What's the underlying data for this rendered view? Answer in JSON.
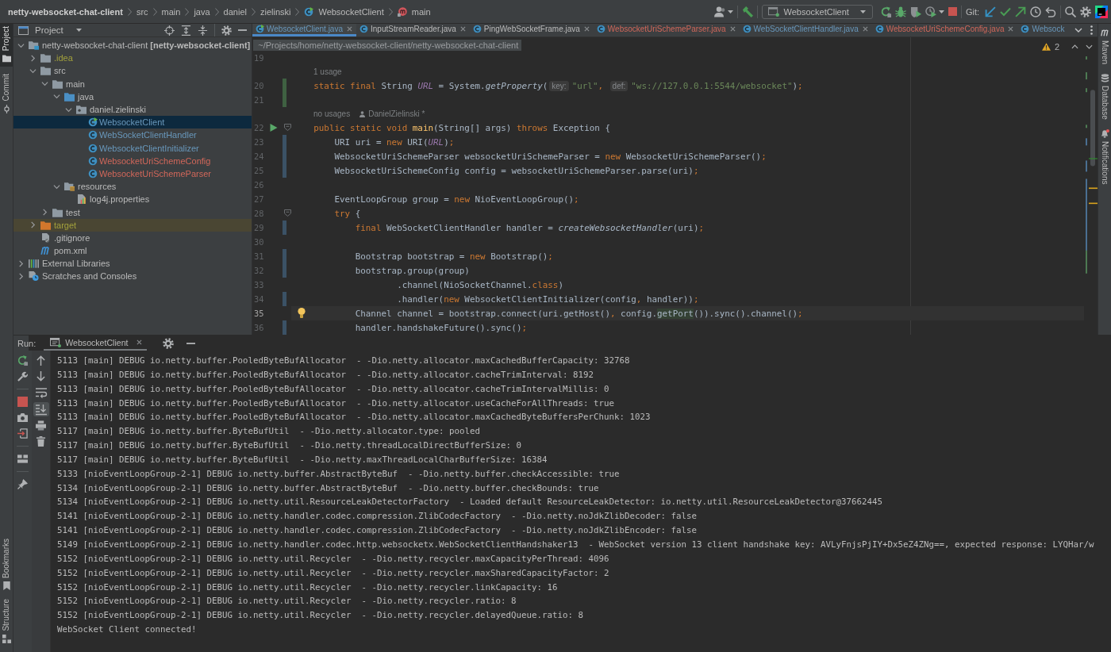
{
  "breadcrumbs": [
    {
      "label": "netty-websocket-chat-client",
      "kind": "project"
    },
    {
      "label": "src",
      "kind": "folder"
    },
    {
      "label": "main",
      "kind": "folder"
    },
    {
      "label": "java",
      "kind": "folder"
    },
    {
      "label": "daniel",
      "kind": "folder"
    },
    {
      "label": "zielinski",
      "kind": "folder"
    },
    {
      "label": "WebsocketClient",
      "kind": "class"
    },
    {
      "label": "main",
      "kind": "method"
    }
  ],
  "toolbar": {
    "run_configuration": "WebsocketClient",
    "vcs_label": "Git:"
  },
  "left_tool_strip": {
    "top": [
      {
        "label": "Project",
        "kind": "project",
        "selected": true
      },
      {
        "label": "Commit",
        "kind": "commit",
        "selected": false
      }
    ],
    "bottom": [
      {
        "label": "Bookmarks",
        "kind": "bookmarks",
        "selected": false
      },
      {
        "label": "Structure",
        "kind": "structure",
        "selected": false
      }
    ]
  },
  "project_panel": {
    "title": "Project",
    "tree": [
      {
        "label": "netty-websocket-chat-client **[netty-websocket-client]**",
        "location": "~/Projects/home/netty-websocket-client/netty-websocket-chat-client",
        "kind": "module",
        "color": "#bbbbbb",
        "expanded": true,
        "selected": false,
        "children": [
          {
            "label": ".idea",
            "kind": "folder",
            "color": "#a3a13c",
            "expanded": false,
            "selected": false
          },
          {
            "label": "src",
            "kind": "folder",
            "color": "#bbbbbb",
            "expanded": true,
            "selected": false,
            "children": [
              {
                "label": "main",
                "kind": "folder",
                "color": "#bbbbbb",
                "expanded": true,
                "selected": false,
                "children": [
                  {
                    "label": "java",
                    "kind": "source_root",
                    "color": "#bbbbbb",
                    "expanded": true,
                    "selected": false,
                    "children": [
                      {
                        "label": "daniel.zielinski",
                        "kind": "package",
                        "color": "#bbbbbb",
                        "expanded": true,
                        "selected": false,
                        "children": [
                          {
                            "label": "WebsocketClient",
                            "kind": "main_class",
                            "color": "#6897bb",
                            "selected": true
                          },
                          {
                            "label": "WebSocketClientHandler",
                            "kind": "class",
                            "color": "#6897bb",
                            "selected": false
                          },
                          {
                            "label": "WebsocketClientInitializer",
                            "kind": "class",
                            "color": "#6897bb",
                            "selected": false
                          },
                          {
                            "label": "WebsocketUriSchemeConfig",
                            "kind": "class",
                            "color": "#d1675a",
                            "selected": false
                          },
                          {
                            "label": "WebsocketUriSchemeParser",
                            "kind": "class",
                            "color": "#d1675a",
                            "selected": false
                          }
                        ]
                      }
                    ]
                  },
                  {
                    "label": "resources",
                    "kind": "resources_root",
                    "color": "#bbbbbb",
                    "expanded": true,
                    "selected": false,
                    "children": [
                      {
                        "label": "log4j.properties",
                        "kind": "properties",
                        "color": "#bbbbbb",
                        "selected": false
                      }
                    ]
                  }
                ]
              },
              {
                "label": "test",
                "kind": "folder",
                "color": "#bbbbbb",
                "expanded": false,
                "selected": false
              }
            ]
          },
          {
            "label": "target",
            "kind": "excluded_folder",
            "color": "#a3a13c",
            "expanded": false,
            "selected": false
          },
          {
            "label": ".gitignore",
            "kind": "gitignore",
            "color": "#bbbbbb",
            "selected": false
          },
          {
            "label": "pom.xml",
            "kind": "maven",
            "color": "#bbbbbb",
            "selected": false
          }
        ]
      },
      {
        "label": "External Libraries",
        "kind": "libraries",
        "color": "#bbbbbb",
        "expanded": false,
        "selected": false
      },
      {
        "label": "Scratches and Consoles",
        "kind": "scratches",
        "color": "#bbbbbb",
        "expanded": false,
        "selected": false
      }
    ]
  },
  "editor": {
    "tabs": [
      {
        "label": "WebsocketClient.java",
        "kind": "main_class",
        "color": "#6897bb",
        "selected": true,
        "closable": true
      },
      {
        "label": "InputStreamReader.java",
        "kind": "class",
        "color": "#bbbbbb",
        "selected": false,
        "closable": true
      },
      {
        "label": "PingWebSocketFrame.java",
        "kind": "class",
        "color": "#bbbbbb",
        "selected": false,
        "closable": true
      },
      {
        "label": "WebsocketUriSchemeParser.java",
        "kind": "class",
        "color": "#d1675a",
        "selected": false,
        "closable": true
      },
      {
        "label": "WebSocketClientHandler.java",
        "kind": "class",
        "color": "#6897bb",
        "selected": false,
        "closable": true
      },
      {
        "label": "WebsocketUriSchemeConfig.java",
        "kind": "class",
        "color": "#d1675a",
        "selected": false,
        "closable": true
      },
      {
        "label": "Websock",
        "kind": "class",
        "color": "#6897bb",
        "selected": false,
        "closable": false
      }
    ],
    "inspection_count": "2",
    "lines": [
      {
        "kind": "code",
        "number": "19",
        "current": false,
        "run_marker": false,
        "bulb": false,
        "fold": false
      },
      {
        "kind": "lens",
        "text": "1 usage"
      },
      {
        "kind": "code",
        "number": "20",
        "color": "#3f6142",
        "current": false,
        "run_marker": false,
        "bulb": false,
        "fold": false,
        "tokens": [
          {
            "kind": "keyword",
            "text": "    static final"
          },
          {
            "kind": "plain",
            "text": " String "
          },
          {
            "kind": "field",
            "text": "URL"
          },
          {
            "kind": "plain",
            "text": " = System."
          },
          {
            "kind": "italic",
            "text": "getProperty"
          },
          {
            "kind": "plain",
            "text": "("
          },
          {
            "kind": "hint",
            "text": "key:"
          },
          {
            "kind": "string",
            "text": "\"url\""
          },
          {
            "kind": "keyword",
            "text": ", "
          },
          {
            "kind": "hint",
            "text": "def:"
          },
          {
            "kind": "string",
            "text": "\"ws://127.0.0.1:5544/websocket\""
          },
          {
            "kind": "plain",
            "text": ")"
          },
          {
            "kind": "keyword",
            "text": ";"
          }
        ]
      },
      {
        "kind": "code",
        "number": "21",
        "color": "#3f6142",
        "current": false,
        "run_marker": false,
        "bulb": false,
        "fold": false
      },
      {
        "kind": "lens",
        "text": "no usages",
        "author": "DanielZielinski *"
      },
      {
        "kind": "code",
        "number": "22",
        "current": false,
        "run_marker": true,
        "bulb": false,
        "fold": true,
        "tokens": [
          {
            "kind": "keyword",
            "text": "    public static void "
          },
          {
            "kind": "declaration",
            "text": "main"
          },
          {
            "kind": "plain",
            "text": "(String[] args) "
          },
          {
            "kind": "keyword",
            "text": "throws"
          },
          {
            "kind": "plain",
            "text": " Exception {"
          }
        ]
      },
      {
        "kind": "code",
        "number": "23",
        "color": "#3b5266",
        "current": false,
        "run_marker": false,
        "bulb": false,
        "fold": false,
        "tokens": [
          {
            "kind": "plain",
            "text": "        URI uri = "
          },
          {
            "kind": "keyword",
            "text": "new"
          },
          {
            "kind": "plain",
            "text": " URI("
          },
          {
            "kind": "field",
            "text": "URL"
          },
          {
            "kind": "plain",
            "text": ")"
          },
          {
            "kind": "keyword",
            "text": ";"
          }
        ]
      },
      {
        "kind": "code",
        "number": "24",
        "color": "#3b5266",
        "current": false,
        "run_marker": false,
        "bulb": false,
        "fold": false,
        "tokens": [
          {
            "kind": "plain",
            "text": "        WebsocketUriSchemeParser websocketUriSchemeParser = "
          },
          {
            "kind": "keyword",
            "text": "new"
          },
          {
            "kind": "plain",
            "text": " WebsocketUriSchemeParser()"
          },
          {
            "kind": "keyword",
            "text": ";"
          }
        ]
      },
      {
        "kind": "code",
        "number": "25",
        "color": "#3b5266",
        "current": false,
        "run_marker": false,
        "bulb": false,
        "fold": false,
        "tokens": [
          {
            "kind": "plain",
            "text": "        WebsocketUriSchemeConfig config = websocketUriSchemeParser.parse(uri)"
          },
          {
            "kind": "keyword",
            "text": ";"
          }
        ]
      },
      {
        "kind": "code",
        "number": "26",
        "current": false,
        "run_marker": false,
        "bulb": false,
        "fold": false
      },
      {
        "kind": "code",
        "number": "27",
        "current": false,
        "run_marker": false,
        "bulb": false,
        "fold": false,
        "tokens": [
          {
            "kind": "plain",
            "text": "        EventLoopGroup group = "
          },
          {
            "kind": "keyword",
            "text": "new"
          },
          {
            "kind": "plain",
            "text": " NioEventLoopGroup()"
          },
          {
            "kind": "keyword",
            "text": ";"
          }
        ]
      },
      {
        "kind": "code",
        "number": "28",
        "current": false,
        "run_marker": false,
        "bulb": false,
        "fold": true,
        "tokens": [
          {
            "kind": "keyword",
            "text": "        try"
          },
          {
            "kind": "plain",
            "text": " {"
          }
        ]
      },
      {
        "kind": "code",
        "number": "29",
        "color": "#3b5266",
        "current": false,
        "run_marker": false,
        "bulb": false,
        "fold": false,
        "tokens": [
          {
            "kind": "keyword",
            "text": "            final"
          },
          {
            "kind": "plain",
            "text": " WebSocketClientHandler handler = "
          },
          {
            "kind": "italic",
            "text": "createWebsocketHandler"
          },
          {
            "kind": "plain",
            "text": "(uri)"
          },
          {
            "kind": "keyword",
            "text": ";"
          }
        ]
      },
      {
        "kind": "code",
        "number": "30",
        "current": false,
        "run_marker": false,
        "bulb": false,
        "fold": false
      },
      {
        "kind": "code",
        "number": "31",
        "color": "#3b5266",
        "current": false,
        "run_marker": false,
        "bulb": false,
        "fold": false,
        "tokens": [
          {
            "kind": "plain",
            "text": "            Bootstrap bootstrap = "
          },
          {
            "kind": "keyword",
            "text": "new"
          },
          {
            "kind": "plain",
            "text": " Bootstrap()"
          },
          {
            "kind": "keyword",
            "text": ";"
          }
        ]
      },
      {
        "kind": "code",
        "number": "32",
        "color": "#3b5266",
        "current": false,
        "run_marker": false,
        "bulb": false,
        "fold": false,
        "tokens": [
          {
            "kind": "plain",
            "text": "            bootstrap.group(group)"
          }
        ]
      },
      {
        "kind": "code",
        "number": "33",
        "current": false,
        "run_marker": false,
        "bulb": false,
        "fold": false,
        "tokens": [
          {
            "kind": "plain",
            "text": "                    .channel(NioSocketChannel."
          },
          {
            "kind": "keyword",
            "text": "class"
          },
          {
            "kind": "plain",
            "text": ")"
          }
        ]
      },
      {
        "kind": "code",
        "number": "34",
        "color": "#3b5266",
        "current": false,
        "run_marker": false,
        "bulb": false,
        "fold": false,
        "tokens": [
          {
            "kind": "plain",
            "text": "                    .handler("
          },
          {
            "kind": "keyword",
            "text": "new"
          },
          {
            "kind": "plain",
            "text": " WebsocketClientInitializer(config"
          },
          {
            "kind": "keyword",
            "text": ", "
          },
          {
            "kind": "plain",
            "text": "handler))"
          },
          {
            "kind": "keyword",
            "text": ";"
          }
        ]
      },
      {
        "kind": "code",
        "number": "35",
        "current": true,
        "run_marker": false,
        "bulb": true,
        "fold": false,
        "tokens": [
          {
            "kind": "plain",
            "text": "            Channel channel = bootstrap.connect(uri.getHost()"
          },
          {
            "kind": "keyword",
            "text": ", "
          },
          {
            "kind": "plain",
            "text": "config."
          },
          {
            "kind": "usage",
            "text": "getPort"
          },
          {
            "kind": "plain",
            "text": "()).sync().channel()"
          },
          {
            "kind": "keyword",
            "text": ";"
          }
        ]
      },
      {
        "kind": "code",
        "number": "36",
        "color": "#3b5266",
        "current": false,
        "run_marker": false,
        "bulb": false,
        "fold": false,
        "tokens": [
          {
            "kind": "plain",
            "text": "            handler.handshakeFuture().sync()"
          },
          {
            "kind": "keyword",
            "text": ";"
          }
        ]
      }
    ]
  },
  "right_tool_strip": [
    {
      "label": "Maven",
      "kind": "maven"
    },
    {
      "label": "Database",
      "kind": "database"
    },
    {
      "label": "Notifications",
      "kind": "notifications",
      "unread": true
    }
  ],
  "run_panel": {
    "title": "Run:",
    "tabs": [
      {
        "label": "WebsocketClient",
        "selected": true
      }
    ],
    "toggles": {
      "soft_wraps": false,
      "scroll_to_end": true
    },
    "console": [
      "5113 [main] DEBUG io.netty.buffer.PooledByteBufAllocator  - -Dio.netty.allocator.maxCachedBufferCapacity: 32768",
      "5113 [main] DEBUG io.netty.buffer.PooledByteBufAllocator  - -Dio.netty.allocator.cacheTrimInterval: 8192",
      "5113 [main] DEBUG io.netty.buffer.PooledByteBufAllocator  - -Dio.netty.allocator.cacheTrimIntervalMillis: 0",
      "5113 [main] DEBUG io.netty.buffer.PooledByteBufAllocator  - -Dio.netty.allocator.useCacheForAllThreads: true",
      "5113 [main] DEBUG io.netty.buffer.PooledByteBufAllocator  - -Dio.netty.allocator.maxCachedByteBuffersPerChunk: 1023",
      "5117 [main] DEBUG io.netty.buffer.ByteBufUtil  - -Dio.netty.allocator.type: pooled",
      "5117 [main] DEBUG io.netty.buffer.ByteBufUtil  - -Dio.netty.threadLocalDirectBufferSize: 0",
      "5117 [main] DEBUG io.netty.buffer.ByteBufUtil  - -Dio.netty.maxThreadLocalCharBufferSize: 16384",
      "5133 [nioEventLoopGroup-2-1] DEBUG io.netty.buffer.AbstractByteBuf  - -Dio.netty.buffer.checkAccessible: true",
      "5134 [nioEventLoopGroup-2-1] DEBUG io.netty.buffer.AbstractByteBuf  - -Dio.netty.buffer.checkBounds: true",
      "5134 [nioEventLoopGroup-2-1] DEBUG io.netty.util.ResourceLeakDetectorFactory  - Loaded default ResourceLeakDetector: io.netty.util.ResourceLeakDetector@37662445",
      "5141 [nioEventLoopGroup-2-1] DEBUG io.netty.handler.codec.compression.ZlibCodecFactory  - -Dio.netty.noJdkZlibDecoder: false",
      "5141 [nioEventLoopGroup-2-1] DEBUG io.netty.handler.codec.compression.ZlibCodecFactory  - -Dio.netty.noJdkZlibEncoder: false",
      "5149 [nioEventLoopGroup-2-1] DEBUG io.netty.handler.codec.http.websocketx.WebSocketClientHandshaker13  - WebSocket version 13 client handshake key: AVLyFnjsPjIY+Dx5eZ4ZNg==, expected response: LYQHar/w",
      "5152 [nioEventLoopGroup-2-1] DEBUG io.netty.util.Recycler  - -Dio.netty.recycler.maxCapacityPerThread: 4096",
      "5152 [nioEventLoopGroup-2-1] DEBUG io.netty.util.Recycler  - -Dio.netty.recycler.maxSharedCapacityFactor: 2",
      "5152 [nioEventLoopGroup-2-1] DEBUG io.netty.util.Recycler  - -Dio.netty.recycler.linkCapacity: 16",
      "5152 [nioEventLoopGroup-2-1] DEBUG io.netty.util.Recycler  - -Dio.netty.recycler.ratio: 8",
      "5152 [nioEventLoopGroup-2-1] DEBUG io.netty.util.Recycler  - -Dio.netty.recycler.delayedQueue.ratio: 8",
      "WebSocket Client connected!"
    ]
  }
}
